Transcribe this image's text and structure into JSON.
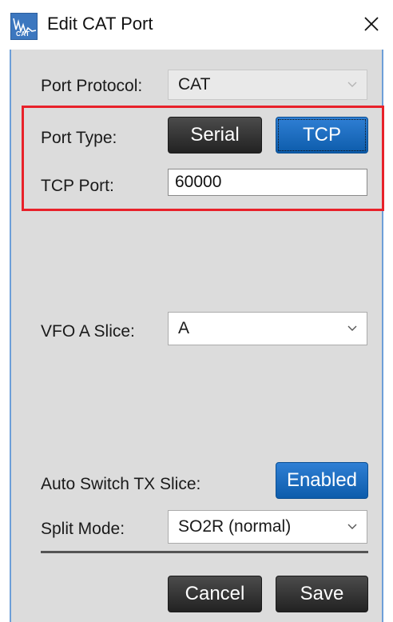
{
  "window": {
    "title": "Edit CAT Port",
    "icon_label": "CAT"
  },
  "form": {
    "port_protocol": {
      "label": "Port Protocol:",
      "value": "CAT"
    },
    "port_type": {
      "label": "Port Type:",
      "options": [
        "Serial",
        "TCP"
      ],
      "selected": "TCP"
    },
    "tcp_port": {
      "label": "TCP Port:",
      "value": "60000"
    },
    "vfo_a_slice": {
      "label": "VFO A Slice:",
      "value": "A"
    },
    "auto_switch_tx": {
      "label": "Auto Switch TX Slice:",
      "button": "Enabled"
    },
    "split_mode": {
      "label": "Split Mode:",
      "value": "SO2R (normal)"
    }
  },
  "actions": {
    "cancel": "Cancel",
    "save": "Save"
  },
  "colors": {
    "highlight": "#e8212a",
    "accent_blue": "#0d5cab",
    "dark_button": "#222222",
    "panel": "#dcdcdc"
  }
}
